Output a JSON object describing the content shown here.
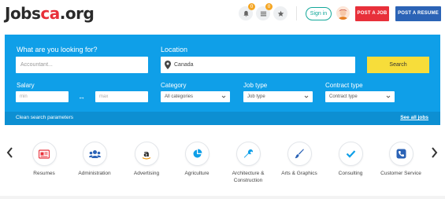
{
  "header": {
    "logo_main": "Jobs",
    "logo_accent": "ca",
    "logo_tld": ".org",
    "notification_count": "0",
    "list_count": "0",
    "signin_label": "Sign in",
    "post_job_label": "POST A JOB",
    "post_resume_label": "POST A RESUME"
  },
  "search": {
    "what_label": "What are you looking for?",
    "what_placeholder": "Accountant...",
    "location_label": "Location",
    "location_value": "Canada",
    "search_button": "Search",
    "salary_label": "Salary",
    "salary_min_placeholder": "min",
    "salary_max_placeholder": "max",
    "category_label": "Category",
    "category_value": "All categories",
    "job_type_label": "Job type",
    "job_type_value": "Job type",
    "contract_type_label": "Contract type",
    "contract_type_value": "Contract type",
    "clean_label": "Clean search parameters",
    "see_all_label": "See all jobs"
  },
  "categories": [
    {
      "label": "Resumes",
      "icon": "resume-icon"
    },
    {
      "label": "Administration",
      "icon": "users-icon"
    },
    {
      "label": "Advertising",
      "icon": "amazon-icon"
    },
    {
      "label": "Agriculture",
      "icon": "pie-chart-icon"
    },
    {
      "label": "Architecture & Construction",
      "icon": "wrench-icon"
    },
    {
      "label": "Arts & Graphics",
      "icon": "brush-icon"
    },
    {
      "label": "Consulting",
      "icon": "check-icon"
    },
    {
      "label": "Customer Service",
      "icon": "phone-icon"
    }
  ],
  "colors": {
    "brand_red": "#e8303a",
    "brand_blue": "#2b63b6",
    "panel_blue": "#0f9fe8",
    "search_yellow": "#f7dd3a",
    "teal": "#14a89a"
  }
}
